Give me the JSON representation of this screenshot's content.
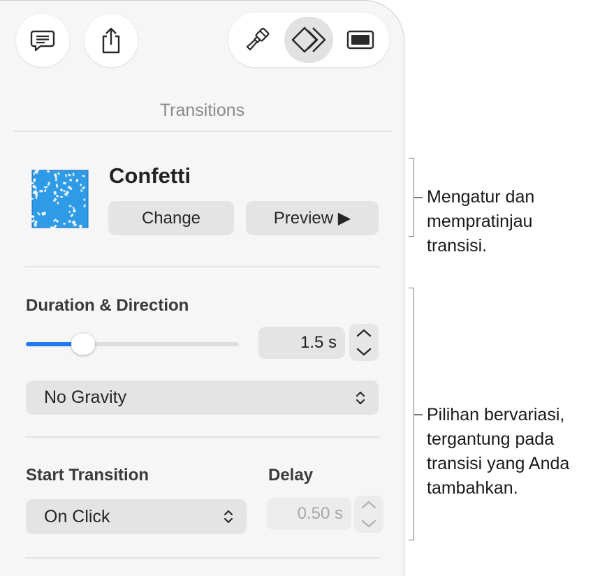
{
  "toolbar": {
    "comment_icon": "comment-icon",
    "share_icon": "share-icon",
    "format_icon": "paintbrush-icon",
    "animate_icon": "diamond-transition-icon",
    "document_icon": "document-icon"
  },
  "panel": {
    "title": "Transitions"
  },
  "transition": {
    "name": "Confetti",
    "change_label": "Change",
    "preview_label": "Preview ▶"
  },
  "duration": {
    "label": "Duration & Direction",
    "value": "1.5 s",
    "slider_fraction": 0.27,
    "direction": "No Gravity"
  },
  "start": {
    "label": "Start Transition",
    "value": "On Click"
  },
  "delay": {
    "label": "Delay",
    "value": "0.50 s"
  },
  "callouts": {
    "top": [
      "Mengatur dan",
      "mempratinjau",
      "transisi."
    ],
    "bottom": [
      "Pilihan bervariasi,",
      "tergantung pada",
      "transisi yang Anda",
      "tambahkan."
    ]
  },
  "colors": {
    "accent": "#1f7bf5",
    "thumbnail": "#2f9be6"
  }
}
